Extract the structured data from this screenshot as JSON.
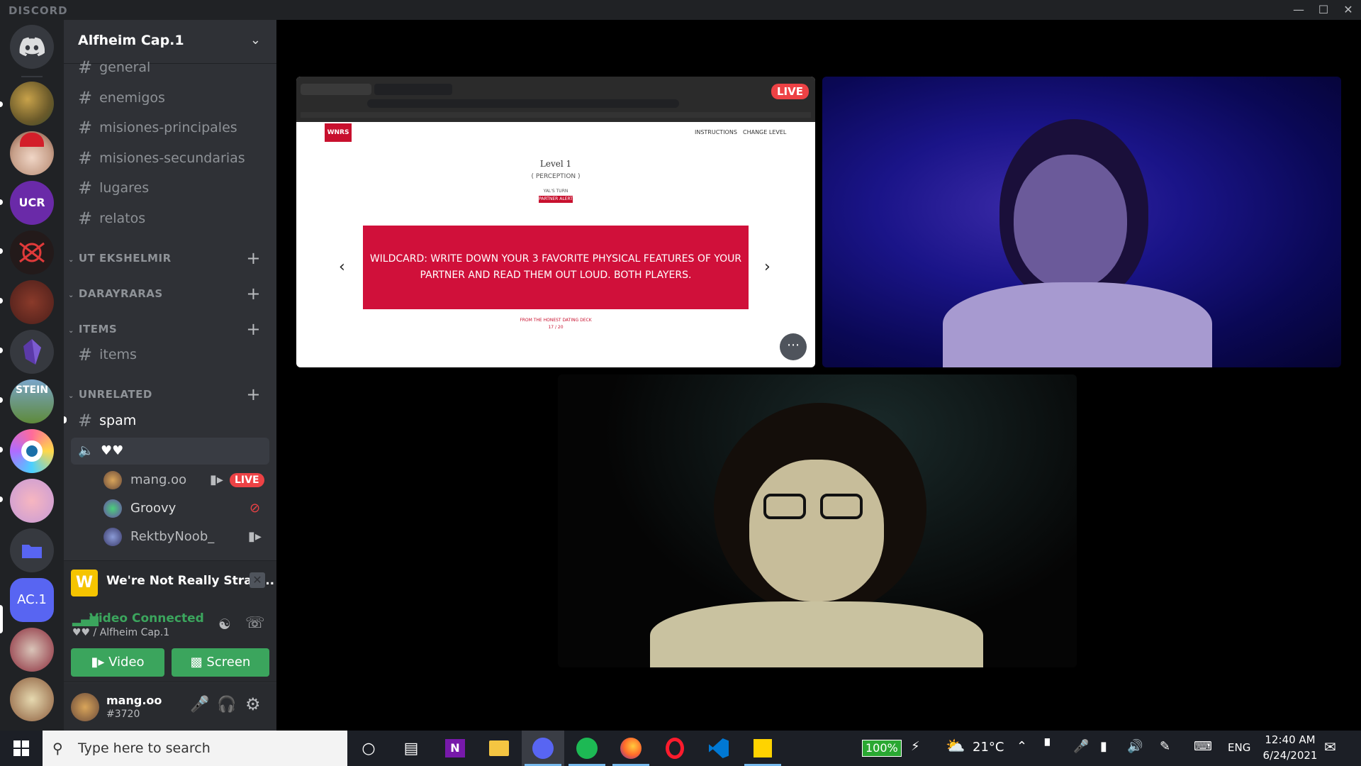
{
  "titlebar": {
    "brand": "DISCORD"
  },
  "server": {
    "name": "Alfheim Cap.1",
    "ac_label": "AC.1",
    "guild_labels": {
      "ucr": "UCR",
      "stein": "STEIN"
    }
  },
  "channels_top": [
    "general",
    "enemigos",
    "misiones-principales",
    "misiones-secundarias",
    "lugares",
    "relatos"
  ],
  "categories": {
    "ut": "UT EKSHELMIR",
    "dar": "DARAYRARAS",
    "items": "ITEMS",
    "unrelated": "UNRELATED"
  },
  "items_channel": "items",
  "spam_channel": "spam",
  "voice_channel": "♥♥",
  "voice_users": [
    {
      "name": "mang.oo",
      "badge": "LIVE"
    },
    {
      "name": "Groovy"
    },
    {
      "name": "RektbyNoob_"
    }
  ],
  "activity": {
    "icon_letter": "W",
    "title": "We're Not Really Stran..."
  },
  "rtc": {
    "status": "Video Connected",
    "location": "♥♥ / Alfheim Cap.1",
    "video_btn": "Video",
    "screen_btn": "Screen"
  },
  "user": {
    "name": "mang.oo",
    "tag": "#3720"
  },
  "stream": {
    "live_badge": "LIVE",
    "nav_instructions": "INSTRUCTIONS",
    "nav_change_level": "CHANGE LEVEL",
    "logo": "WNRS",
    "level": "Level 1",
    "level_sub": "( PERCEPTION )",
    "turn": "YAL'S TURN",
    "partner_alert": "PARTNER ALERT",
    "card_text": "WILDCARD: WRITE DOWN YOUR 3 FAVORITE PHYSICAL FEATURES OF YOUR PARTNER AND READ THEM OUT LOUD. BOTH PLAYERS.",
    "deck": "FROM THE HONEST DATING DECK",
    "count": "17 / 20"
  },
  "taskbar": {
    "search_placeholder": "Type here to search",
    "battery": "100%",
    "temp": "21°C",
    "lang": "ENG",
    "time": "12:40 AM",
    "date": "6/24/2021"
  },
  "colors": {
    "accent": "#3ba55d",
    "live": "#ed4245",
    "card": "#d0103a",
    "sidebar": "#2f3136",
    "guilds": "#202225"
  }
}
